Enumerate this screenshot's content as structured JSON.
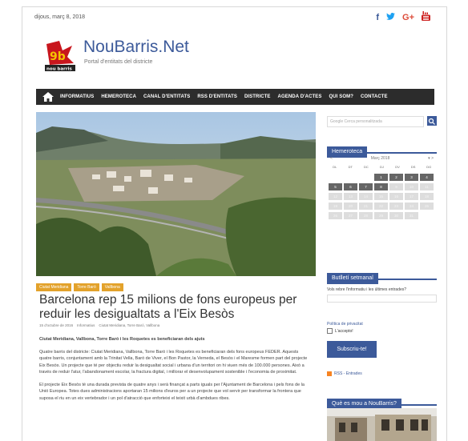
{
  "topbar": {
    "date": "dijous, març 8, 2018",
    "social": {
      "facebook_glyph": "f",
      "twitter_glyph": "t",
      "googleplus_glyph": "G+",
      "youtube_glyph": "You"
    }
  },
  "brand": {
    "title": "NouBarris.Net",
    "tagline": "Portal d'entitats del districte"
  },
  "nav": {
    "items": [
      "INFORMATIUS",
      "HEMEROTECA",
      "CANAL D'ENTITATS",
      "RSS D'ENTITATS",
      "DISTRICTE",
      "AGENDA D'ACTES",
      "QUI SOM?",
      "CONTACTE"
    ]
  },
  "post": {
    "categories": [
      "Ciutat Meridiana",
      "Torre Baró",
      "Vallbona"
    ],
    "title": "Barcelona rep 15 milions de fons europeus per reduir les desigualtats a l'Eix Besòs",
    "meta": {
      "date": "15 d'octubre de 2016",
      "author": "Informatius",
      "tags": "Ciutat Meridiana, Torre Baró, Vallbona"
    },
    "lead": "Ciutat Meridiana, Vallbona, Torre Baró i les Roquetes es beneficiaran dels ajuts",
    "paragraphs": [
      "Quatre barris del districte: Ciutat Meridiana, Vallbona, Torre Baró i les Roquetes es beneficiaran dels fons europeus FEDER. Aquests quatre barris, conjuntament amb la Trinitat Vella, Baró de Viver, el Bon Pastor, la Verneda, el Besòs i el Maresme formen part del projecte Eix Besòs. Un projecte que té per objectiu reduir la desigualtat social i urbana d'un territori on hi viuen més de 100.000 persones. Això a través de reduir l'atur, l'abandonament escolar, la fractura digital, i millorar el desenvolupament sostenible i l'economia de proximitat.",
      "El projecte Eix Besòs té una durada prevista de quatre anys i serà finançat a parts iguals per l'Ajuntament de Barcelona i pels fons de la Unió Europea. Totes dues administracions aportaran 15 milions d'euros per a un projecte que vol servir per transformar la frontera que suposa el riu en un eix vertebrador i un pol d'atracció que enforteixi el teixit urbà d'ambdues ribes."
    ]
  },
  "sidebar": {
    "search": {
      "google_label": "Google",
      "placeholder": "Cerca personalitzada"
    },
    "hemeroteca": {
      "title": "Hemeroteca",
      "prev": "<",
      "month": "Març 2018",
      "next": "▾ >",
      "days": [
        "DL",
        "DT",
        "DC",
        "DJ",
        "DV",
        "DS",
        "DG"
      ],
      "cells": [
        "",
        "",
        "",
        "1",
        "2",
        "3",
        "4",
        "5",
        "6",
        "7",
        "8",
        "9",
        "10",
        "11",
        "12",
        "13",
        "14",
        "15",
        "16",
        "17",
        "18",
        "19",
        "20",
        "21",
        "22",
        "23",
        "24",
        "25",
        "26",
        "27",
        "28",
        "29",
        "30",
        "31",
        ""
      ]
    },
    "butlleti": {
      "title": "Butlletí setmanal",
      "question": "Vols rebre l'informatiu i les últimes entrades?",
      "privacy": "Política de privacitat",
      "accept": "L'accepto!",
      "button": "Subscriu-te!"
    },
    "rss": "RSS - Entrades",
    "que_es_mou": {
      "title": "Què es mou a NouBarris?"
    }
  }
}
